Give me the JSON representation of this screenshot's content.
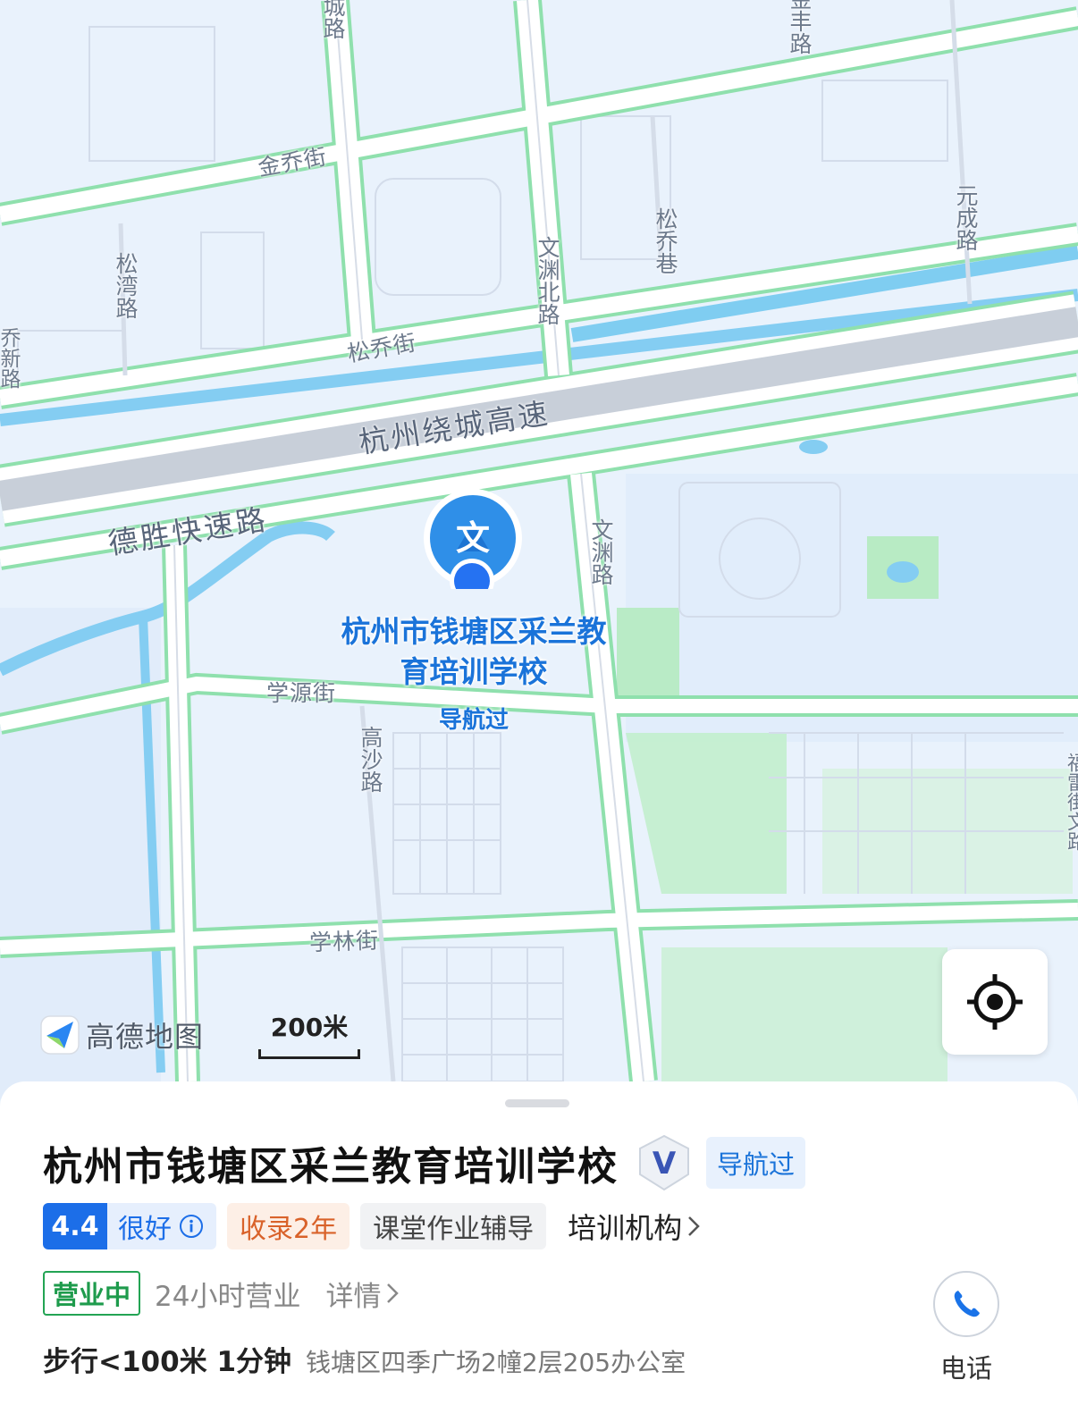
{
  "map": {
    "roads": {
      "cheng_lu": "城路",
      "jinfeng_lu": "金丰路",
      "jinqiao_jie": "金乔街",
      "songwan_lu": "松湾路",
      "wenyuan_bei_lu": "文渊北路",
      "songqiao_xiang": "松乔巷",
      "yuancheng_lu": "元成路",
      "songqiao_jie": "松乔街",
      "left_edge_road": "乔新路",
      "ring_expressway": "杭州绕城高速",
      "desheng_expressway": "德胜快速路",
      "wenyuan_lu": "文渊路",
      "xueyuan_jie": "学源街",
      "gaosha_lu": "高沙路",
      "xuelin_jie": "学林街",
      "right_edge_road": "福雷街文路"
    },
    "poi": {
      "label": "杭州市钱塘区采兰教育培训学校",
      "sub_label": "导航过",
      "pin_icon": "education-pin-icon",
      "pin_glyph": "文"
    },
    "logo_text": "高德地图",
    "scale_text": "200米",
    "colors": {
      "road_outline": "#8fe0ad",
      "road_fill": "#ffffff",
      "expressway_fill": "#c8cfd9",
      "water": "#84cdf2",
      "park": "#b8ebc4",
      "accent_blue": "#1a73d9"
    }
  },
  "place": {
    "title": "杭州市钱塘区采兰教育培训学校",
    "verified_badge": "V",
    "nav_tag": "导航过",
    "rating_score": "4.4",
    "rating_word": "很好",
    "years_tag": "收录2年",
    "service_tag": "课堂作业辅导",
    "category": "培训机构",
    "open_status": "营业中",
    "hours": "24小时营业",
    "detail_link": "详情",
    "distance": "步行<100米 1分钟",
    "address": "钱塘区四季广场2幢2层205办公室",
    "phone_label": "电话"
  }
}
